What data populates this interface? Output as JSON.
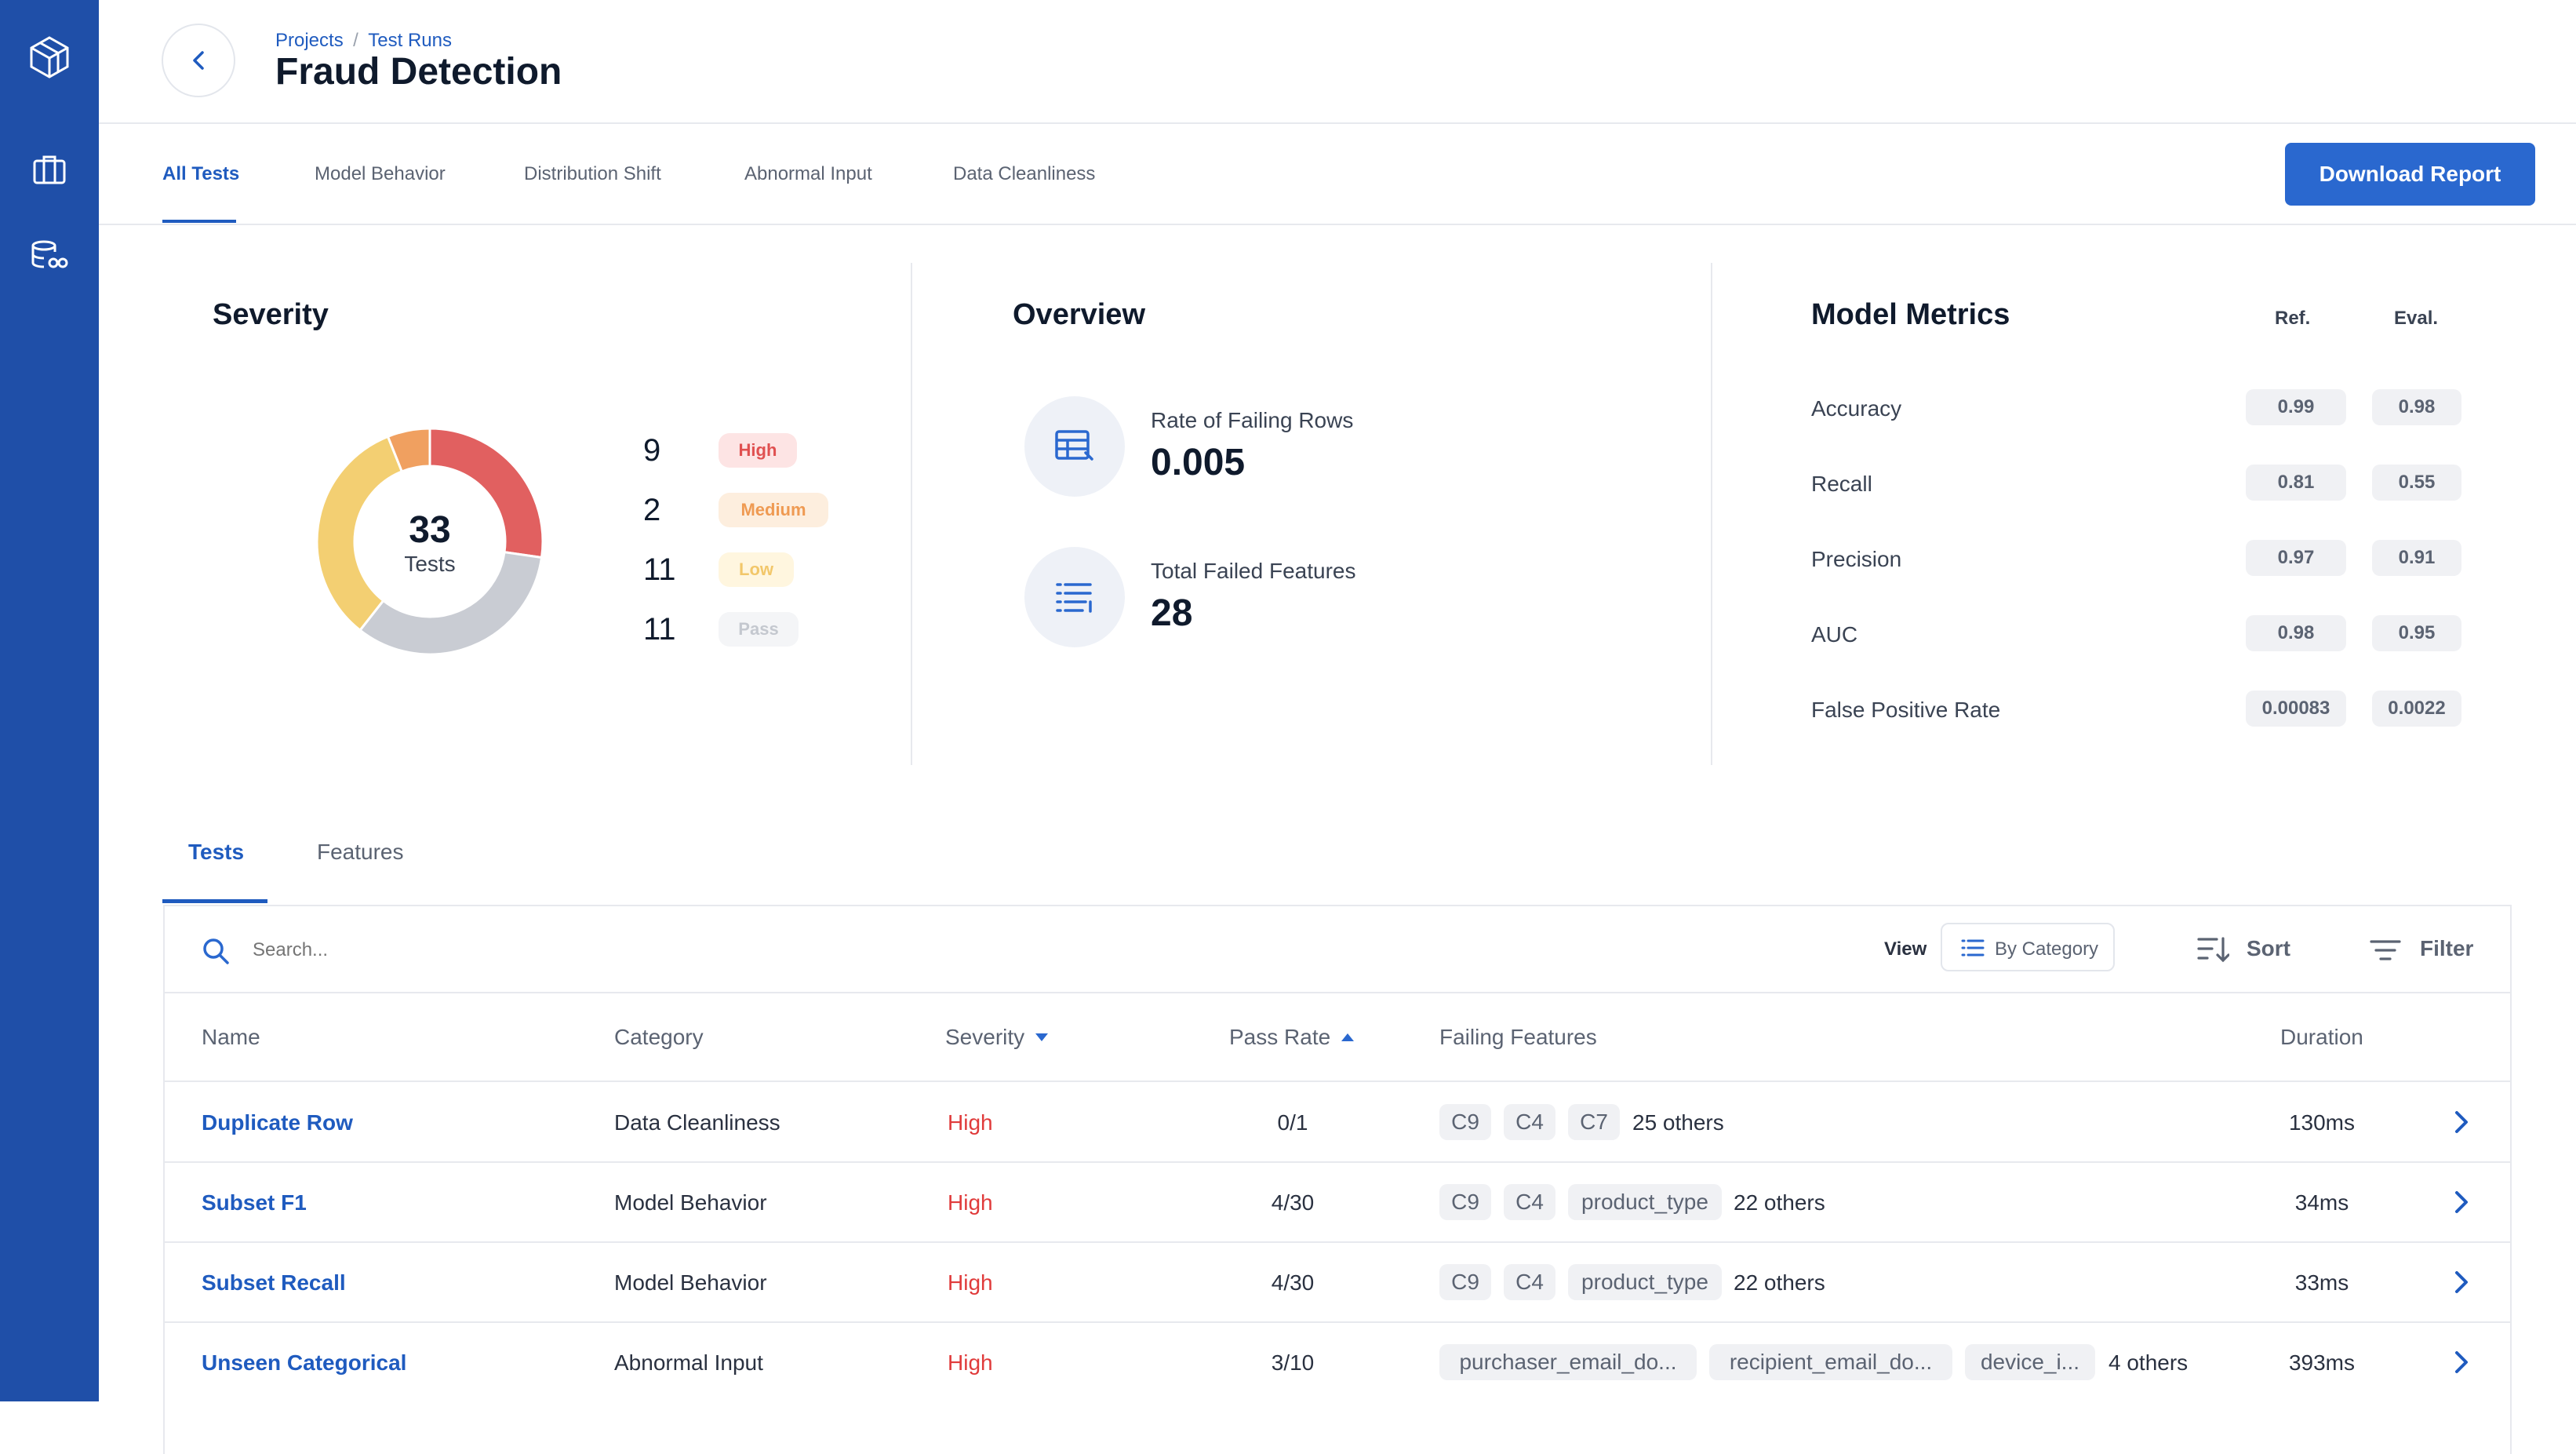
{
  "breadcrumb": [
    "Projects",
    "/",
    "Test Runs"
  ],
  "page_title": "Fraud Detection",
  "top_tabs": [
    "All Tests",
    "Model Behavior",
    "Distribution Shift",
    "Abnormal Input",
    "Data Cleanliness"
  ],
  "download_button": "Download Report",
  "severity": {
    "title": "Severity",
    "total": "33",
    "total_label": "Tests",
    "items": [
      {
        "count": "9",
        "label": "High",
        "color": "#e16060"
      },
      {
        "count": "2",
        "label": "Medium",
        "color": "#f0a060"
      },
      {
        "count": "11",
        "label": "Low",
        "color": "#f3cf72"
      },
      {
        "count": "11",
        "label": "Pass",
        "color": "#c9ccd3"
      }
    ]
  },
  "overview": {
    "title": "Overview",
    "items": [
      {
        "label": "Rate of Failing Rows",
        "value": "0.005",
        "icon": "table-icon"
      },
      {
        "label": "Total Failed Features",
        "value": "28",
        "icon": "list-icon"
      }
    ]
  },
  "model_metrics": {
    "title": "Model Metrics",
    "col_ref": "Ref.",
    "col_eval": "Eval.",
    "rows": [
      {
        "name": "Accuracy",
        "ref": "0.99",
        "eval": "0.98"
      },
      {
        "name": "Recall",
        "ref": "0.81",
        "eval": "0.55"
      },
      {
        "name": "Precision",
        "ref": "0.97",
        "eval": "0.91"
      },
      {
        "name": "AUC",
        "ref": "0.98",
        "eval": "0.95"
      },
      {
        "name": "False Positive Rate",
        "ref": "0.00083",
        "eval": "0.0022"
      }
    ]
  },
  "bottom_tabs": [
    "Tests",
    "Features"
  ],
  "toolbar": {
    "search_placeholder": "Search...",
    "view_label": "View",
    "view_value": "By Category",
    "sort_label": "Sort",
    "filter_label": "Filter"
  },
  "table": {
    "headers": [
      "Name",
      "Category",
      "Severity",
      "Pass Rate",
      "Failing Features",
      "Duration"
    ],
    "rows": [
      {
        "name": "Duplicate Row",
        "category": "Data Cleanliness",
        "severity": "High",
        "pass_rate": "0/1",
        "features": [
          "C9",
          "C4",
          "C7"
        ],
        "others": "25 others",
        "duration": "130ms"
      },
      {
        "name": "Subset F1",
        "category": "Model Behavior",
        "severity": "High",
        "pass_rate": "4/30",
        "features": [
          "C9",
          "C4",
          "product_type"
        ],
        "others": "22 others",
        "duration": "34ms"
      },
      {
        "name": "Subset Recall",
        "category": "Model Behavior",
        "severity": "High",
        "pass_rate": "4/30",
        "features": [
          "C9",
          "C4",
          "product_type"
        ],
        "others": "22 others",
        "duration": "33ms"
      },
      {
        "name": "Unseen Categorical",
        "category": "Abnormal Input",
        "severity": "High",
        "pass_rate": "3/10",
        "features": [
          "purchaser_email_do...",
          "recipient_email_do...",
          "device_i..."
        ],
        "others": "4 others",
        "duration": "393ms"
      }
    ]
  }
}
